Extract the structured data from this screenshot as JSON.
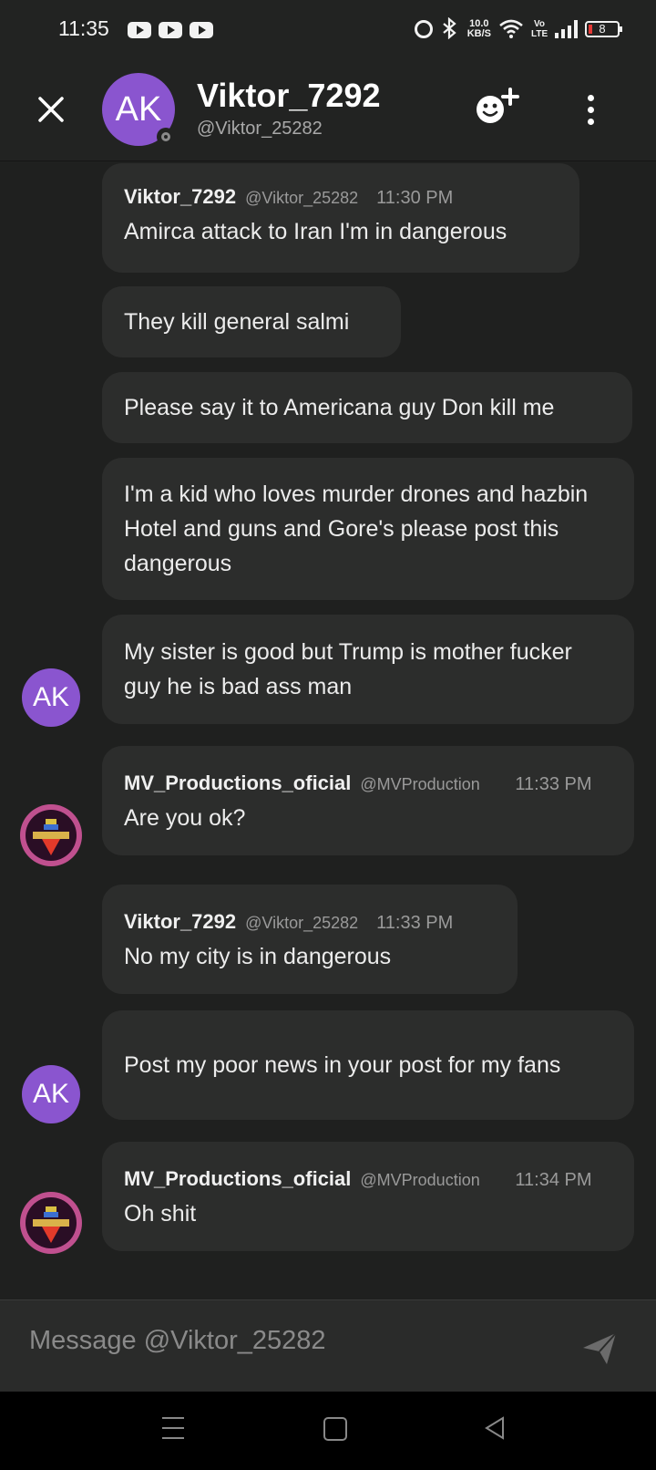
{
  "status_bar": {
    "time": "11:35",
    "speed_value": "10.0",
    "speed_unit": "KB/S",
    "network_label": "Vo LTE",
    "battery": "8",
    "icons": [
      "youtube-icon",
      "youtube-icon",
      "youtube-icon",
      "alarm-icon",
      "bluetooth-icon",
      "wifi-icon",
      "signal-icon",
      "battery-icon"
    ]
  },
  "header": {
    "avatar_initials": "AK",
    "name": "Viktor_7292",
    "handle": "@Viktor_25282",
    "online_status": "offline",
    "icons": [
      "close-icon",
      "add-friend-icon",
      "more-icon"
    ]
  },
  "messages": [
    {
      "author": "Viktor_7292",
      "handle": "@Viktor_25282",
      "time": "11:30 PM",
      "text": "Amirca attack to Iran I'm in dangerous"
    },
    {
      "text": "They kill general salmi"
    },
    {
      "text": "Please say it to Americana guy Don kill me"
    },
    {
      "text": "I'm a kid who loves murder drones and hazbin Hotel and guns and Gore's please post this dangerous"
    },
    {
      "text": "My sister is good but Trump is mother fucker guy he is bad ass man",
      "avatar": "AK"
    },
    {
      "author": "MV_Productions_oficial",
      "handle": "@MVProduction",
      "time": "11:33 PM",
      "text": "Are you ok?"
    },
    {
      "author": "Viktor_7292",
      "handle": "@Viktor_25282",
      "time": "11:33 PM",
      "text": "No my city is in dangerous"
    },
    {
      "text": "Post my poor news in your post for my fans",
      "avatar": "AK"
    },
    {
      "author": "MV_Productions_oficial",
      "handle": "@MVProduction",
      "time": "11:34 PM",
      "text": "Oh shit"
    }
  ],
  "composer": {
    "placeholder": "Message @Viktor_25282"
  },
  "colors": {
    "background": "#1f201f",
    "bubble": "#2c2d2c",
    "avatar": "#8a55cf",
    "accent_avatar": "#c0508f"
  }
}
